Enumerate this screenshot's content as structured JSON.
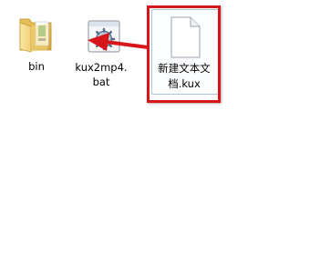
{
  "files": [
    {
      "name": "bin",
      "icon": "folder-icon"
    },
    {
      "name": "kux2mp4.bat",
      "name_line1": "kux2mp4.",
      "name_line2": "bat",
      "icon": "batch-file-icon"
    },
    {
      "name": "新建文本文档.kux",
      "name_line1": "新建文本文",
      "name_line2": "档.kux",
      "icon": "blank-document-icon",
      "selected": true
    }
  ],
  "annotation": {
    "highlight_color": "#d7161c",
    "arrow_color": "#d7161c"
  }
}
